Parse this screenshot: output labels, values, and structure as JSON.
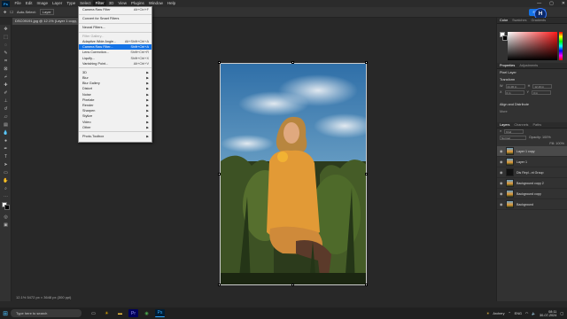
{
  "menubar": {
    "logo": "Ps",
    "items": [
      "File",
      "Edit",
      "Image",
      "Layer",
      "Type",
      "Select",
      "Filter",
      "3D",
      "View",
      "Plugins",
      "Window",
      "Help"
    ],
    "active_index": 6,
    "window_controls": [
      "—",
      "▢",
      "✕"
    ]
  },
  "options_bar": {
    "auto_select_label": "Auto-Select:",
    "auto_select_value": "Layer",
    "share_label": "Share"
  },
  "document": {
    "tab_title": "DSC09191.jpg @ 12.1% (Layer 1 copy, RGB/8) *",
    "status": "12.1%    5472 px × 3648 px (300 ppi)"
  },
  "filter_menu": {
    "items": [
      {
        "label": "Camera Raw Filter",
        "shortcut": "Alt+Ctrl+F",
        "type": "item"
      },
      {
        "type": "sep"
      },
      {
        "label": "Convert for Smart Filters",
        "type": "item"
      },
      {
        "type": "sep"
      },
      {
        "label": "Neural Filters...",
        "type": "item"
      },
      {
        "type": "sep"
      },
      {
        "label": "Filter Gallery...",
        "type": "disabled"
      },
      {
        "label": "Adaptive Wide Angle...",
        "shortcut": "Alt+Shift+Ctrl+A",
        "type": "item"
      },
      {
        "label": "Camera Raw Filter...",
        "shortcut": "Shift+Ctrl+A",
        "type": "highlight"
      },
      {
        "label": "Lens Correction...",
        "shortcut": "Shift+Ctrl+R",
        "type": "item"
      },
      {
        "label": "Liquify...",
        "shortcut": "Shift+Ctrl+X",
        "type": "item"
      },
      {
        "label": "Vanishing Point...",
        "shortcut": "Alt+Ctrl+V",
        "type": "item"
      },
      {
        "type": "sep"
      },
      {
        "label": "3D",
        "type": "submenu"
      },
      {
        "label": "Blur",
        "type": "submenu"
      },
      {
        "label": "Blur Gallery",
        "type": "submenu"
      },
      {
        "label": "Distort",
        "type": "submenu"
      },
      {
        "label": "Noise",
        "type": "submenu"
      },
      {
        "label": "Pixelate",
        "type": "submenu"
      },
      {
        "label": "Render",
        "type": "submenu"
      },
      {
        "label": "Sharpen",
        "type": "submenu"
      },
      {
        "label": "Stylize",
        "type": "submenu"
      },
      {
        "label": "Video",
        "type": "submenu"
      },
      {
        "label": "Other",
        "type": "submenu"
      },
      {
        "type": "sep"
      },
      {
        "label": "Photo-Toolbox",
        "type": "submenu"
      }
    ]
  },
  "right_panel": {
    "color_tabs": [
      "Color",
      "Swatches",
      "Gradients"
    ],
    "properties_tabs": [
      "Properties",
      "Adjustments"
    ],
    "pixel_layer": "Pixel Layer",
    "transform_title": "Transform",
    "w_value": "21.36 in",
    "h_value": "12.16 in",
    "x_value": "0 in",
    "y_value": "0 in",
    "align_title": "Align and Distribute",
    "align_more": "More",
    "layers_tabs": [
      "Layers",
      "Channels",
      "Paths"
    ],
    "kind_label": "Kind",
    "blend_mode": "Normal",
    "opacity_label": "Opacity: 100%",
    "fill_label": "Fill: 100%",
    "layers": [
      {
        "name": "Layer 1 copy",
        "selected": true
      },
      {
        "name": "Layer 1",
        "selected": false
      },
      {
        "name": "Dis Repl...nt Group",
        "selected": false
      },
      {
        "name": "Background copy 2",
        "selected": false
      },
      {
        "name": "Background copy",
        "selected": false
      },
      {
        "name": "Background",
        "selected": false
      }
    ]
  },
  "avatar_initial": "H",
  "taskbar": {
    "search_placeholder": "Type here to search",
    "weather": "Archery",
    "lang": "ENG",
    "time": "08:11",
    "date": "30-07-2024"
  },
  "colors": {
    "accent": "#1473e6",
    "menu_bg": "#f1f1f1",
    "panel_bg": "#323232"
  }
}
